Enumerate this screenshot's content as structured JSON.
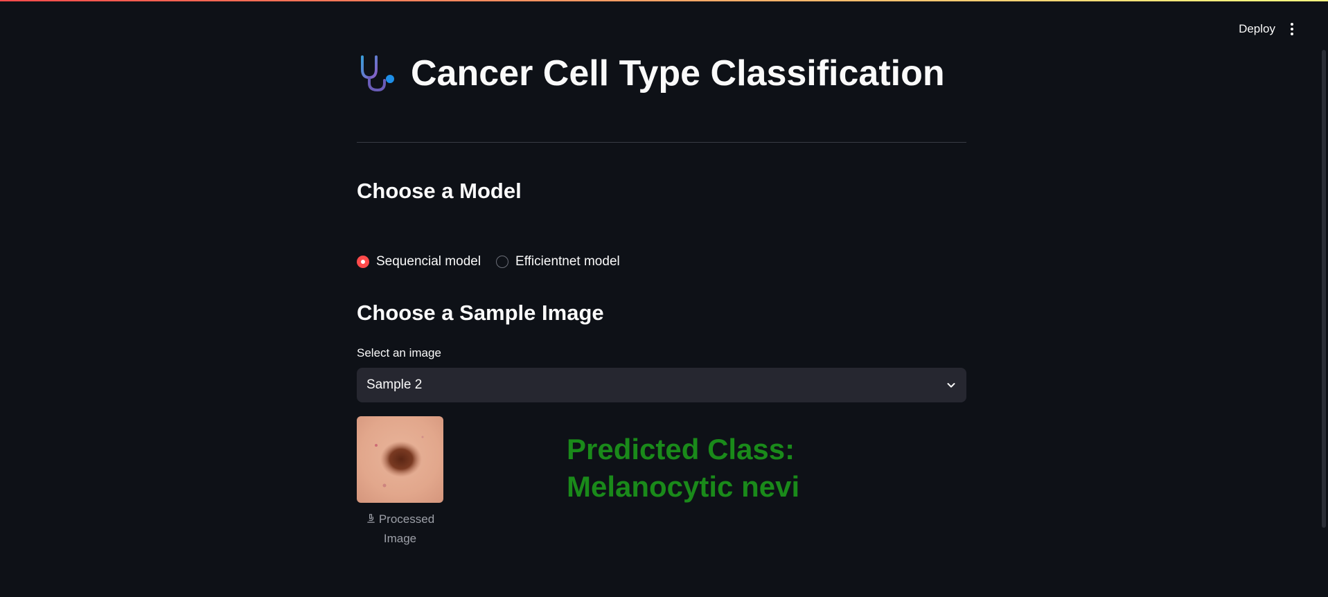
{
  "header": {
    "deploy_label": "Deploy",
    "menu_icon": "vertical-dots-icon"
  },
  "title": {
    "icon": "stethoscope-icon",
    "text": "Cancer Cell Type Classification"
  },
  "model_section": {
    "heading": "Choose a Model",
    "options": [
      {
        "label": "Sequencial model",
        "selected": true
      },
      {
        "label": "Efficientnet model",
        "selected": false
      }
    ]
  },
  "sample_section": {
    "heading": "Choose a Sample Image",
    "select_label": "Select an image",
    "selected_value": "Sample 2"
  },
  "result": {
    "caption_line1": "Processed",
    "caption_line2": "Image",
    "caption_icon": "microscope-icon",
    "prediction_line1": "Predicted Class:",
    "prediction_line2": "Melanocytic nevi"
  },
  "colors": {
    "background": "#0e1117",
    "accent": "#ff4b4b",
    "prediction": "#1a8a1a",
    "select_bg": "#262730"
  }
}
